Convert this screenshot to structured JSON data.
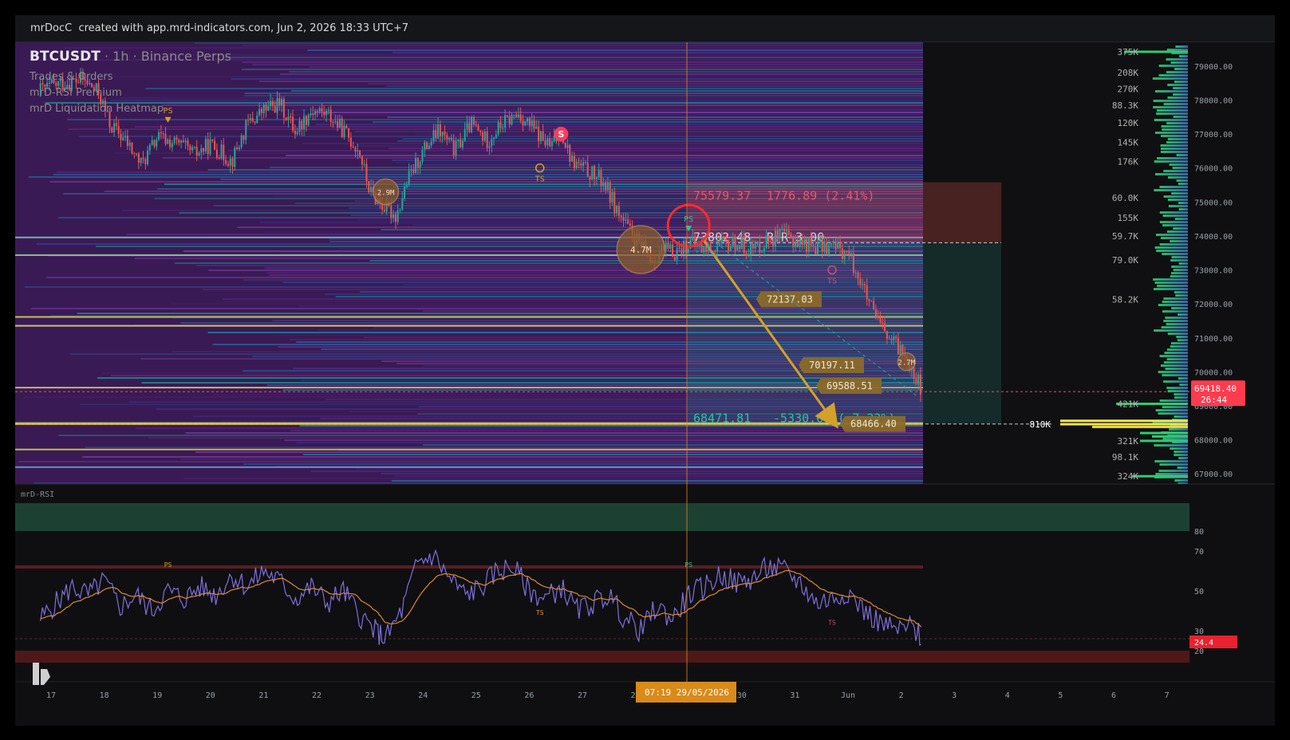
{
  "header": {
    "author": "mrDocC",
    "credit": "created with app.mrd-indicators.com, Jun 2, 2026 18:33 UTC+7"
  },
  "legend": {
    "symbol": "BTCUSDT",
    "subtitle": "· 1h · Binance Perps",
    "indicators": [
      "Trades & Orders",
      "mrD-RSI Premium",
      "mrD Liquidation Heatmap"
    ]
  },
  "colors": {
    "up": "#26a69a",
    "down": "#ef5350",
    "short_target": "#ef5350",
    "entry": "#9e9e9e",
    "tp": "#26a69a",
    "arrow": "#d4a02a",
    "price_tag": "#ff4757",
    "rsi_line": "#7e6fd9",
    "rsi_ma": "#e08a2a",
    "crosshair": "#e08a2a"
  },
  "price_axis": {
    "min": 66700,
    "max": 79700,
    "ticks": [
      "79000.00",
      "78000.00",
      "77000.00",
      "76000.00",
      "75000.00",
      "74000.00",
      "73000.00",
      "72000.00",
      "71000.00",
      "70000.00",
      "69000.00",
      "68000.00",
      "67000.00"
    ]
  },
  "time_axis": {
    "labels": [
      "17",
      "18",
      "19",
      "20",
      "21",
      "22",
      "23",
      "24",
      "25",
      "26",
      "27",
      "28",
      "29",
      "30",
      "31",
      "Jun",
      "2",
      "3",
      "4",
      "5",
      "6",
      "7"
    ],
    "crosshair_label": "07:19  29/05/2026"
  },
  "current_price": {
    "price": 69418.4,
    "label": "69418.40",
    "countdown": "26:44"
  },
  "chart_data": {
    "type": "candlestick",
    "title": "BTCUSDT · 1h · Binance Perps",
    "ylim": [
      66700,
      79700
    ],
    "x_categories": [
      "17",
      "18",
      "19",
      "20",
      "21",
      "22",
      "23",
      "24",
      "25",
      "26",
      "27",
      "28",
      "29",
      "30",
      "31",
      "Jun",
      "2"
    ],
    "close_path": [
      {
        "x": "16.8",
        "y": 78300
      },
      {
        "x": "17.2",
        "y": 78500
      },
      {
        "x": "17.6",
        "y": 78600
      },
      {
        "x": "17.9",
        "y": 78200
      },
      {
        "x": "18.1",
        "y": 77300
      },
      {
        "x": "18.4",
        "y": 76800
      },
      {
        "x": "18.7",
        "y": 76100
      },
      {
        "x": "19.0",
        "y": 76900
      },
      {
        "x": "19.4",
        "y": 76700
      },
      {
        "x": "19.7",
        "y": 76400
      },
      {
        "x": "20.0",
        "y": 76700
      },
      {
        "x": "20.4",
        "y": 76200
      },
      {
        "x": "20.7",
        "y": 77300
      },
      {
        "x": "21.0",
        "y": 77700
      },
      {
        "x": "21.3",
        "y": 77900
      },
      {
        "x": "21.6",
        "y": 77100
      },
      {
        "x": "21.9",
        "y": 77700
      },
      {
        "x": "22.2",
        "y": 77600
      },
      {
        "x": "22.5",
        "y": 77100
      },
      {
        "x": "22.8",
        "y": 76500
      },
      {
        "x": "23.0",
        "y": 75300
      },
      {
        "x": "23.3",
        "y": 74800
      },
      {
        "x": "23.5",
        "y": 74600
      },
      {
        "x": "23.7",
        "y": 75600
      },
      {
        "x": "24.0",
        "y": 76500
      },
      {
        "x": "24.3",
        "y": 77100
      },
      {
        "x": "24.6",
        "y": 76500
      },
      {
        "x": "24.9",
        "y": 77300
      },
      {
        "x": "25.2",
        "y": 76800
      },
      {
        "x": "25.5",
        "y": 77300
      },
      {
        "x": "25.8",
        "y": 77600
      },
      {
        "x": "26.1",
        "y": 77100
      },
      {
        "x": "26.4",
        "y": 76600
      },
      {
        "x": "26.6",
        "y": 77100
      },
      {
        "x": "26.8",
        "y": 76200
      },
      {
        "x": "27.1",
        "y": 75900
      },
      {
        "x": "27.4",
        "y": 75600
      },
      {
        "x": "27.7",
        "y": 74600
      },
      {
        "x": "27.9",
        "y": 74100
      },
      {
        "x": "28.1",
        "y": 73700
      },
      {
        "x": "28.3",
        "y": 73300
      },
      {
        "x": "28.5",
        "y": 73600
      },
      {
        "x": "28.7",
        "y": 73500
      },
      {
        "x": "29.0",
        "y": 73800
      },
      {
        "x": "29.3",
        "y": 73600
      },
      {
        "x": "29.6",
        "y": 73700
      },
      {
        "x": "29.9",
        "y": 73800
      },
      {
        "x": "30.2",
        "y": 73600
      },
      {
        "x": "30.5",
        "y": 73900
      },
      {
        "x": "30.8",
        "y": 74000
      },
      {
        "x": "31.1",
        "y": 73800
      },
      {
        "x": "31.4",
        "y": 73700
      },
      {
        "x": "31.7",
        "y": 73700
      },
      {
        "x": "Jun",
        "y": 73500
      },
      {
        "x": "1.2",
        "y": 72800
      },
      {
        "x": "1.5",
        "y": 71600
      },
      {
        "x": "1.8",
        "y": 70900
      },
      {
        "x": "2.1",
        "y": 70500
      },
      {
        "x": "2.4",
        "y": 69400
      }
    ],
    "position": {
      "side": "short",
      "stop_label": "75579.37",
      "stop_info": "1776.89 (2.41%)",
      "entry_label": "73802.48",
      "rr_label": "R:R 3.00",
      "target_label": "68471.81",
      "target_info": "-5330.67 (-7.22%)"
    },
    "levels": [
      {
        "price": 72137.03,
        "label": "72137.03"
      },
      {
        "price": 70197.11,
        "label": "70197.11"
      },
      {
        "price": 69588.51,
        "label": "69588.51"
      },
      {
        "price": 68466.4,
        "label": "68466.40"
      }
    ],
    "liquidation_bubbles": [
      {
        "label": "2.9M",
        "x": "23.3",
        "price": 75300
      },
      {
        "label": "4.7M",
        "x": "28.1",
        "price": 73600
      },
      {
        "label": "2.7M",
        "x": "2.1",
        "price": 70300
      }
    ],
    "signals": [
      {
        "label": "PS",
        "x": "19.2",
        "price": 77500,
        "kind": "ps"
      },
      {
        "label": "TS",
        "x": "26.2",
        "price": 76000,
        "kind": "ts"
      },
      {
        "label": "S",
        "x": "26.6",
        "price": 77000,
        "kind": "sell"
      },
      {
        "label": "PS",
        "x": "29.0",
        "price": 74300,
        "kind": "ps-green"
      },
      {
        "label": "TS",
        "x": "31.7",
        "price": 73000,
        "kind": "ts-red"
      }
    ],
    "volume_profile": [
      {
        "label": "375K",
        "price": 79420
      },
      {
        "label": "208K",
        "price": 78810
      },
      {
        "label": "270K",
        "price": 78330
      },
      {
        "label": "88.3K",
        "price": 77850
      },
      {
        "label": "120K",
        "price": 77330
      },
      {
        "label": "145K",
        "price": 76760
      },
      {
        "label": "176K",
        "price": 76190
      },
      {
        "label": "60.0K",
        "price": 75120
      },
      {
        "label": "155K",
        "price": 74540
      },
      {
        "label": "59.7K",
        "price": 74000
      },
      {
        "label": "79.0K",
        "price": 73290
      },
      {
        "label": "58.2K",
        "price": 72130
      },
      {
        "label": "421K",
        "price": 69060
      },
      {
        "label": "810K",
        "price": 68460
      },
      {
        "label": "321K",
        "price": 67970
      },
      {
        "label": "98.1K",
        "price": 67500
      },
      {
        "label": "324K",
        "price": 66930
      }
    ],
    "rsi": {
      "name": "mrD-RSI",
      "ylim": [
        14,
        94
      ],
      "ticks": [
        "80",
        "70",
        "50",
        "30",
        "20"
      ],
      "current": "24.4",
      "signals": [
        {
          "label": "PS",
          "x": "19.2",
          "value": 62
        },
        {
          "label": "TS",
          "x": "26.2",
          "value": 38
        },
        {
          "label": "PS",
          "x": "29.0",
          "value": 62
        },
        {
          "label": "TS",
          "x": "31.7",
          "value": 33
        }
      ],
      "values": [
        {
          "x": "16.8",
          "v": 36
        },
        {
          "x": "17.1",
          "v": 44
        },
        {
          "x": "17.4",
          "v": 52
        },
        {
          "x": "17.7",
          "v": 48
        },
        {
          "x": "18.0",
          "v": 55
        },
        {
          "x": "18.3",
          "v": 42
        },
        {
          "x": "18.6",
          "v": 48
        },
        {
          "x": "18.9",
          "v": 40
        },
        {
          "x": "19.2",
          "v": 50
        },
        {
          "x": "19.5",
          "v": 46
        },
        {
          "x": "19.8",
          "v": 52
        },
        {
          "x": "20.1",
          "v": 48
        },
        {
          "x": "20.4",
          "v": 58
        },
        {
          "x": "20.7",
          "v": 52
        },
        {
          "x": "21.0",
          "v": 60
        },
        {
          "x": "21.3",
          "v": 55
        },
        {
          "x": "21.6",
          "v": 46
        },
        {
          "x": "21.9",
          "v": 52
        },
        {
          "x": "22.2",
          "v": 44
        },
        {
          "x": "22.5",
          "v": 50
        },
        {
          "x": "22.8",
          "v": 38
        },
        {
          "x": "23.1",
          "v": 30
        },
        {
          "x": "23.3",
          "v": 26
        },
        {
          "x": "23.6",
          "v": 40
        },
        {
          "x": "23.9",
          "v": 64
        },
        {
          "x": "24.2",
          "v": 68
        },
        {
          "x": "24.5",
          "v": 56
        },
        {
          "x": "24.8",
          "v": 48
        },
        {
          "x": "25.1",
          "v": 52
        },
        {
          "x": "25.4",
          "v": 60
        },
        {
          "x": "25.7",
          "v": 62
        },
        {
          "x": "26.0",
          "v": 50
        },
        {
          "x": "26.3",
          "v": 46
        },
        {
          "x": "26.6",
          "v": 52
        },
        {
          "x": "26.9",
          "v": 40
        },
        {
          "x": "27.2",
          "v": 44
        },
        {
          "x": "27.5",
          "v": 48
        },
        {
          "x": "27.8",
          "v": 36
        },
        {
          "x": "28.1",
          "v": 30
        },
        {
          "x": "28.4",
          "v": 42
        },
        {
          "x": "28.7",
          "v": 36
        },
        {
          "x": "29.0",
          "v": 48
        },
        {
          "x": "29.3",
          "v": 52
        },
        {
          "x": "29.6",
          "v": 58
        },
        {
          "x": "29.9",
          "v": 54
        },
        {
          "x": "30.2",
          "v": 56
        },
        {
          "x": "30.5",
          "v": 62
        },
        {
          "x": "30.8",
          "v": 60
        },
        {
          "x": "31.1",
          "v": 54
        },
        {
          "x": "31.4",
          "v": 44
        },
        {
          "x": "31.7",
          "v": 46
        },
        {
          "x": "Jun",
          "v": 50
        },
        {
          "x": "1.3",
          "v": 40
        },
        {
          "x": "1.6",
          "v": 34
        },
        {
          "x": "1.9",
          "v": 30
        },
        {
          "x": "2.2",
          "v": 32
        },
        {
          "x": "2.4",
          "v": 26
        }
      ]
    }
  }
}
